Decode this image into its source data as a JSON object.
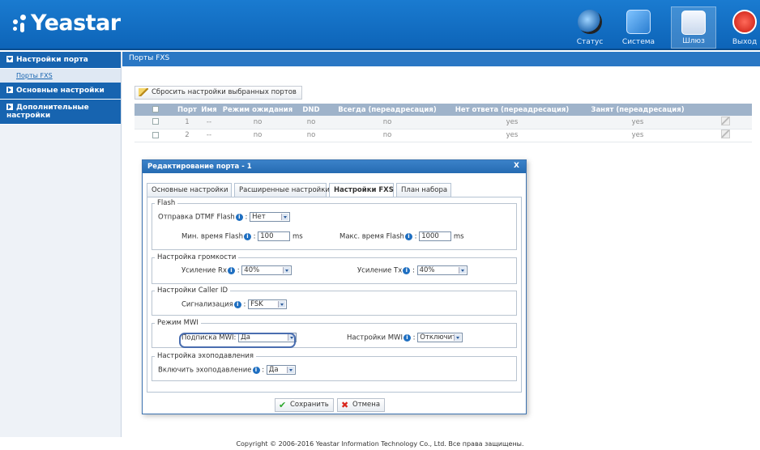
{
  "header": {
    "brand": "Yeastar",
    "nav": [
      {
        "label": "Статус",
        "icon": "status-icon"
      },
      {
        "label": "Система",
        "icon": "system-icon"
      },
      {
        "label": "Шлюз",
        "icon": "gateway-icon"
      },
      {
        "label": "Выход",
        "icon": "logout-icon"
      }
    ]
  },
  "sidebar": {
    "port_settings": "Настройки порта",
    "fxs_ports": "Порты FXS",
    "basic_settings": "Основные настройки",
    "advanced_settings": "Дополнительные настройки"
  },
  "main": {
    "title": "Порты FXS",
    "reset_button": "Сбросить настройки выбранных портов",
    "table": {
      "headers": [
        "Порт",
        "Имя",
        "Режим ожидания",
        "DND",
        "Всегда (переадресация)",
        "Нет ответа (переадресация)",
        "Занят (переадресация)"
      ],
      "rows": [
        [
          "1",
          "--",
          "no",
          "no",
          "no",
          "yes",
          "yes"
        ],
        [
          "2",
          "--",
          "no",
          "no",
          "no",
          "yes",
          "yes"
        ]
      ]
    }
  },
  "dialog": {
    "title": "Редактирование порта - 1",
    "close": "X",
    "tabs": [
      "Основные настройки",
      "Расширенные настройки",
      "Настройки FXS",
      "План набора"
    ],
    "flash": {
      "legend": "Flash",
      "dtmf_label": "Отправка DTMF Flash",
      "dtmf_value": "Нет",
      "min_label": "Мин. время Flash",
      "min_value": "100",
      "max_label": "Макс. время Flash",
      "max_value": "1000",
      "unit": "ms"
    },
    "volume": {
      "legend": "Настройка громкости",
      "rx_label": "Усиление Rx",
      "rx_value": "40%",
      "tx_label": "Усиление Tx",
      "tx_value": "40%"
    },
    "callerid": {
      "legend": "Настройки Caller ID",
      "signal_label": "Сигнализация",
      "signal_value": "FSK"
    },
    "mwi": {
      "legend": "Режим MWI",
      "sub_label": "Подписка MWI:",
      "sub_value": "Да",
      "settings_label": "Настройки MWI",
      "settings_value": "Отключит"
    },
    "echo": {
      "legend": "Настройка эхоподавления",
      "enable_label": "Включить эхоподавление",
      "enable_value": "Да"
    },
    "save": "Сохранить",
    "cancel": "Отмена"
  },
  "footer": "Copyright © 2006-2016 Yeastar Information Technology Co., Ltd. Все права защищены.",
  "info_glyph": "i",
  "colors": {
    "header": "#1a7bd0",
    "sidebar_head": "#1764b0",
    "table_head": "#9fb3ca",
    "highlight": "#4a6eb0"
  }
}
